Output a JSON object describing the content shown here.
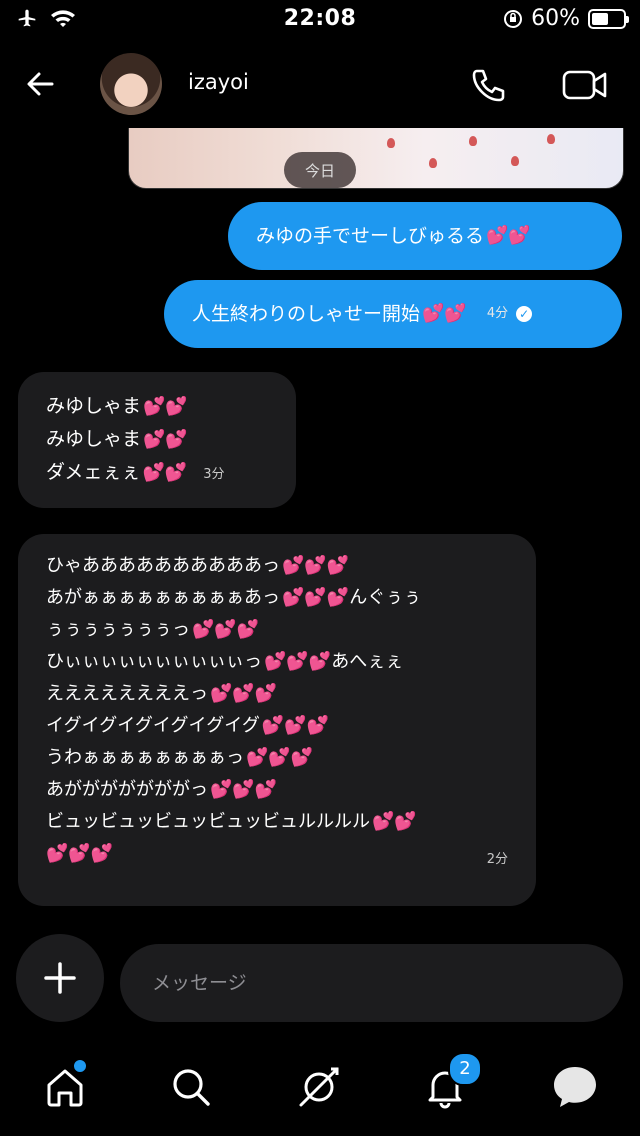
{
  "status": {
    "time": "22:08",
    "battery": "60%",
    "battery_level": 0.6
  },
  "header": {
    "username": "izayoi"
  },
  "chat": {
    "day_label": "今日",
    "outgoing": [
      {
        "text": "みゆの手でせーしびゅるる",
        "hearts": "💕💕"
      },
      {
        "text": "人生終わりのしゃせー開始",
        "hearts": "💕💕",
        "time": "4分",
        "read": "✓"
      }
    ],
    "incoming1": {
      "lines": [
        {
          "text": "みゆしゃま",
          "hearts": "💕💕"
        },
        {
          "text": "みゆしゃま",
          "hearts": "💕💕"
        },
        {
          "text": "ダメェぇぇ",
          "hearts": "💕💕"
        }
      ],
      "time": "3分"
    },
    "incoming2": {
      "lines": [
        {
          "text": "ひゃああああああああああっ",
          "hearts": "💕💕💕"
        },
        {
          "text": "あがぁぁぁぁぁぁぁぁぁあっ",
          "hearts": "💕💕💕",
          "after": "んぐぅぅ"
        },
        {
          "text": "ぅぅぅぅぅぅぅっ",
          "hearts": "💕💕💕"
        },
        {
          "text": "ひぃぃぃぃぃぃぃぃぃぃっ",
          "hearts": "💕💕💕",
          "after": "あへぇぇ"
        },
        {
          "text": "ええええええええっ",
          "hearts": "💕💕💕"
        },
        {
          "text": "イグイグイグイグイグイグ",
          "hearts": "💕💕💕"
        },
        {
          "text": "うわぁぁぁぁぁぁぁぁっ",
          "hearts": "💕💕💕"
        },
        {
          "text": "あがががががががっ",
          "hearts": "💕💕💕"
        },
        {
          "text": "ビュッビュッビュッビュッビュルルルル",
          "hearts": "💕💕"
        },
        {
          "text": "",
          "hearts": "💕💕💕"
        }
      ],
      "time": "2分"
    }
  },
  "composer": {
    "placeholder": "メッセージ"
  },
  "tabs": {
    "notifications_badge": "2"
  },
  "colors": {
    "accent": "#1e98f0",
    "incoming_bubble": "#1c1c1e",
    "background": "#000000"
  }
}
